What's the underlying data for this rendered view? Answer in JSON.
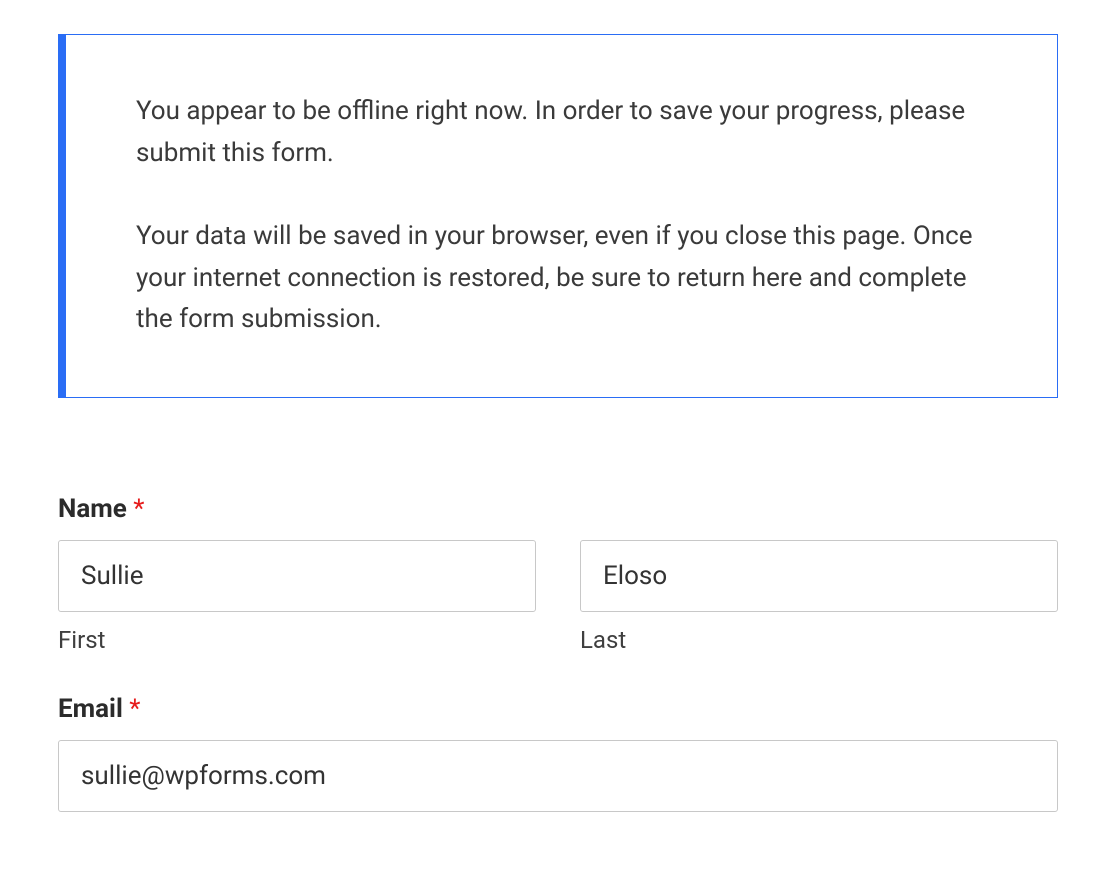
{
  "notice": {
    "p1": "You appear to be offline right now. In order to save your progress, please submit this form.",
    "p2": "Your data will be saved in your browser, even if you close this page. Once your internet connection is restored, be sure to return here and complete the form submission."
  },
  "form": {
    "name": {
      "label": "Name",
      "required_mark": "*",
      "first": {
        "value": "Sullie",
        "sublabel": "First"
      },
      "last": {
        "value": "Eloso",
        "sublabel": "Last"
      }
    },
    "email": {
      "label": "Email",
      "required_mark": "*",
      "value": "sullie@wpforms.com"
    }
  }
}
